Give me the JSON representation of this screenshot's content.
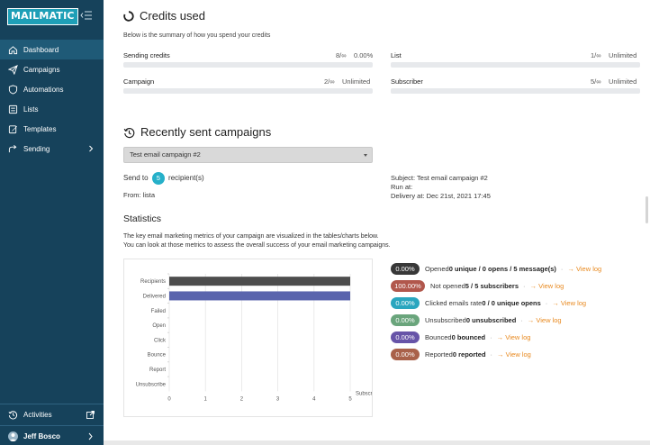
{
  "app": {
    "logo": "MAILMATIC"
  },
  "sidebar": {
    "items": [
      {
        "label": "Dashboard",
        "icon": "home-icon",
        "active": true
      },
      {
        "label": "Campaigns",
        "icon": "paper-plane-icon"
      },
      {
        "label": "Automations",
        "icon": "shield-icon"
      },
      {
        "label": "Lists",
        "icon": "list-icon"
      },
      {
        "label": "Templates",
        "icon": "edit-icon"
      },
      {
        "label": "Sending",
        "icon": "send-icon",
        "has_children": true
      }
    ],
    "bottom": {
      "activities": "Activities",
      "user": "Jeff Bosco"
    }
  },
  "credits": {
    "title": "Credits used",
    "subtitle": "Below is the summary of how you spend your credits",
    "items": [
      {
        "label": "Sending credits",
        "used": "8/∞",
        "value": "0.00%"
      },
      {
        "label": "List",
        "used": "1/∞",
        "value": "Unlimited"
      },
      {
        "label": "Campaign",
        "used": "2/∞",
        "value": "Unlimited"
      },
      {
        "label": "Subscriber",
        "used": "5/∞",
        "value": "Unlimited"
      }
    ]
  },
  "recent": {
    "title": "Recently sent campaigns",
    "selected_campaign": "Test email campaign #2",
    "send_to_prefix": "Send to",
    "recipient_count": "5",
    "send_to_suffix": "recipient(s)",
    "from": "From: lista",
    "subject": "Subject: Test email campaign #2",
    "run_at": "Run at:",
    "delivery_at": "Delivery at: Dec 21st, 2021 17:45"
  },
  "statistics": {
    "title": "Statistics",
    "desc1": "The key email marketing metrics of your campaign are visualized in the tables/charts below.",
    "desc2": "You can look at those metrics to assess the overall success of your email marketing campaigns."
  },
  "chart_data": {
    "type": "bar",
    "orientation": "horizontal",
    "categories": [
      "Recipients",
      "Delivered",
      "Failed",
      "Open",
      "Click",
      "Bounce",
      "Report",
      "Unsubscribe"
    ],
    "values": [
      5,
      5,
      0,
      0,
      0,
      0,
      0,
      0
    ],
    "bar_colors": [
      "#4d4d4d",
      "#5a64ad",
      null,
      null,
      null,
      null,
      null,
      null
    ],
    "xlabel": "Subscribers",
    "xlim": [
      0,
      5
    ],
    "xticks": [
      "0",
      "1",
      "2",
      "3",
      "4",
      "5"
    ],
    "grid": true
  },
  "metrics": [
    {
      "pct": "0.00%",
      "color": "#383838",
      "pre": "Opened ",
      "bold": "0 unique / 0 opens / 5 message(s)",
      "post": "",
      "link": "→ View log"
    },
    {
      "pct": "100.00%",
      "color": "#b1574c",
      "pre": "Not opened ",
      "bold": "5 / 5 subscribers",
      "post": "",
      "link": "→ View log"
    },
    {
      "pct": "0.00%",
      "color": "#2aa6bf",
      "pre": "Clicked emails rate ",
      "bold": "0 / 0 unique opens",
      "post": "",
      "link": "→ View log"
    },
    {
      "pct": "0.00%",
      "color": "#6aa57c",
      "pre": "Unsubscribed ",
      "bold": "0 unsubscribed",
      "post": "",
      "link": "→ View log"
    },
    {
      "pct": "0.00%",
      "color": "#6754a8",
      "pre": "Bounced ",
      "bold": "0 bounced",
      "post": "",
      "link": "→ View log"
    },
    {
      "pct": "0.00%",
      "color": "#a9614a",
      "pre": "Reported ",
      "bold": "0 reported",
      "post": "",
      "link": "→ View log"
    }
  ]
}
